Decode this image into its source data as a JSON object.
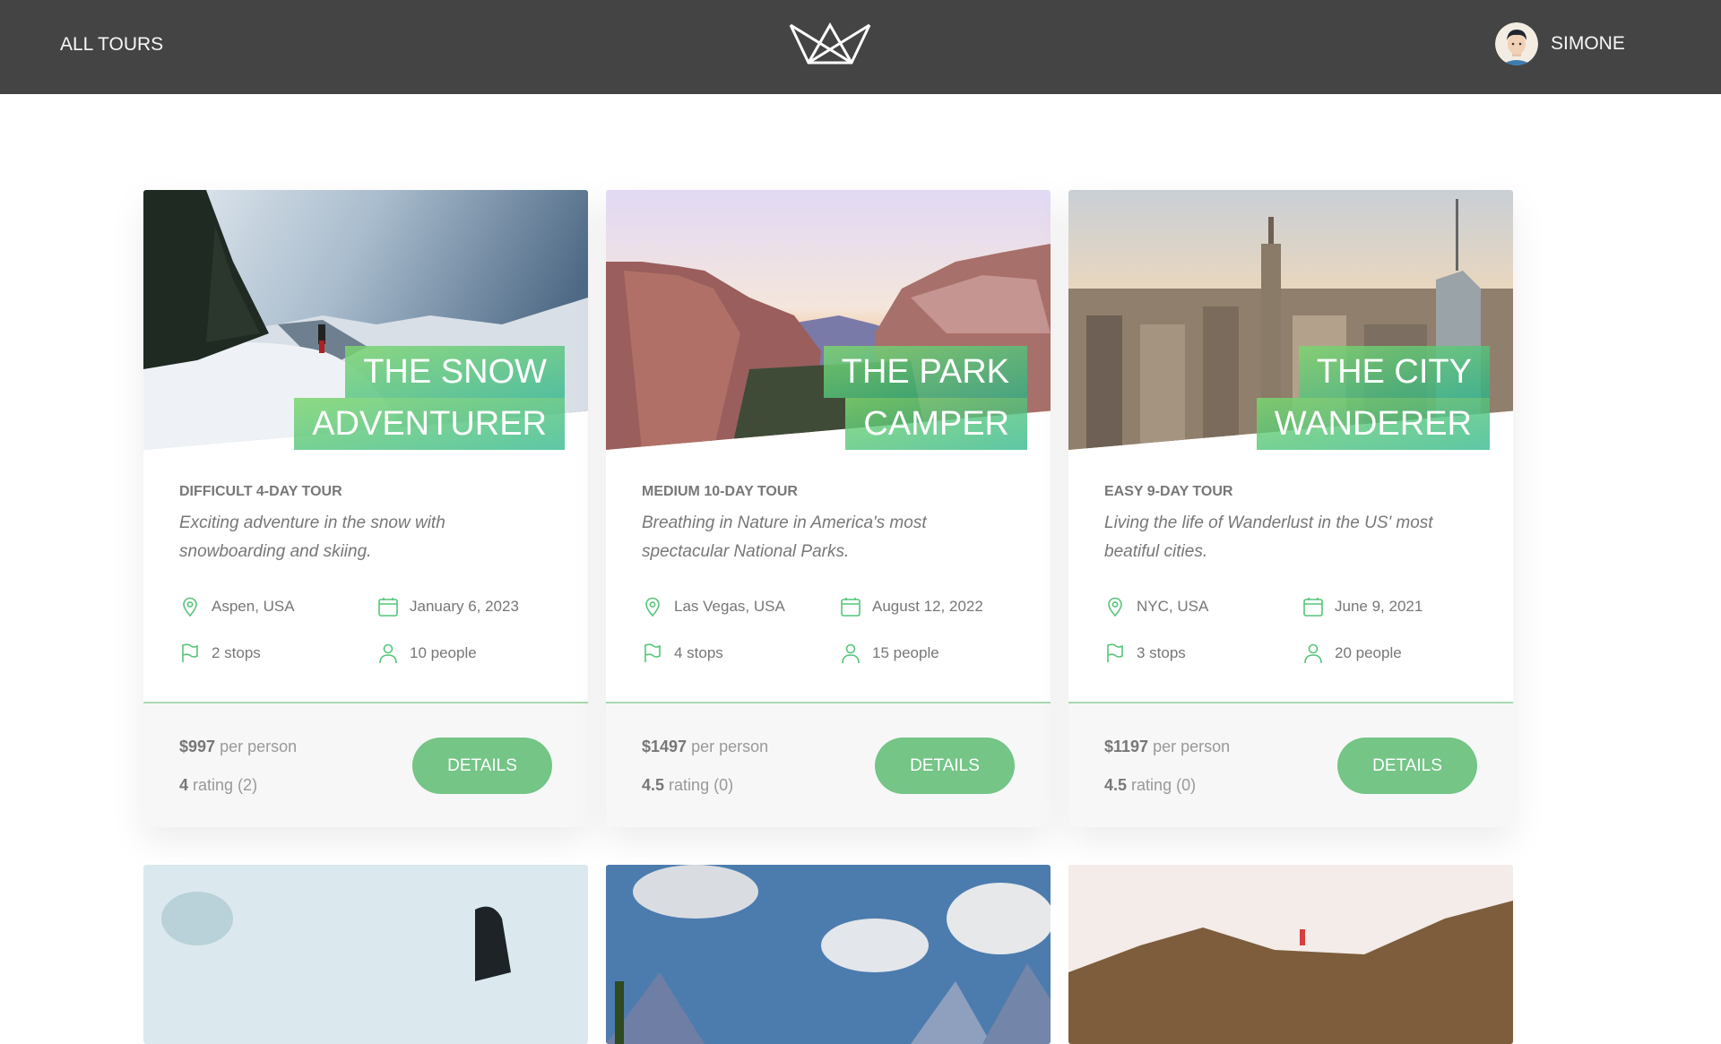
{
  "header": {
    "nav_link": "ALL TOURS",
    "logo_icon": "crown-logo-icon",
    "user": {
      "name": "SIMONE",
      "avatar_icon": "user-avatar-icon"
    }
  },
  "colors": {
    "header_bg": "#444444",
    "accent_green": "#74c586",
    "text": "#777777"
  },
  "tours": [
    {
      "title_line1": "THE SNOW",
      "title_line2": "ADVENTURER",
      "subheading": "DIFFICULT 4-DAY TOUR",
      "summary": "Exciting adventure in the snow with snowboarding and skiing.",
      "location": "Aspen, USA",
      "date": "January 6, 2023",
      "stops": "2 stops",
      "people": "10 people",
      "price": "$997",
      "price_unit": "per person",
      "rating": "4",
      "rating_label": "rating (2)",
      "button": "DETAILS"
    },
    {
      "title_line1": "THE PARK",
      "title_line2": "CAMPER",
      "subheading": "MEDIUM 10-DAY TOUR",
      "summary": "Breathing in Nature in America's most spectacular National Parks.",
      "location": "Las Vegas, USA",
      "date": "August 12, 2022",
      "stops": "4 stops",
      "people": "15 people",
      "price": "$1497",
      "price_unit": "per person",
      "rating": "4.5",
      "rating_label": "rating (0)",
      "button": "DETAILS"
    },
    {
      "title_line1": "THE CITY",
      "title_line2": "WANDERER",
      "subheading": "EASY 9-DAY TOUR",
      "summary": "Living the life of Wanderlust in the US' most beatiful cities.",
      "location": "NYC, USA",
      "date": "June 9, 2021",
      "stops": "3 stops",
      "people": "20 people",
      "price": "$1197",
      "price_unit": "per person",
      "rating": "4.5",
      "rating_label": "rating (0)",
      "button": "DETAILS"
    }
  ]
}
